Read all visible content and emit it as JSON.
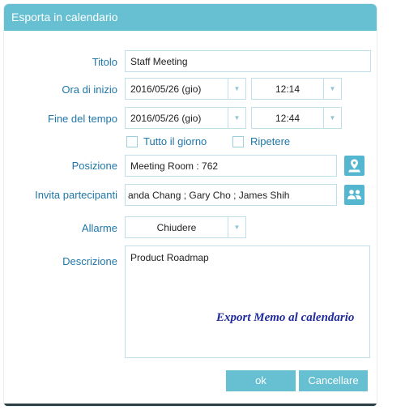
{
  "dialog": {
    "title": "Esporta in calendario"
  },
  "form": {
    "titolo": {
      "label": "Titolo",
      "value": "Staff Meeting"
    },
    "ora_inizio": {
      "label": "Ora di inizio",
      "date": "2016/05/26 (gio)",
      "time": "12:14"
    },
    "fine_tempo": {
      "label": "Fine del tempo",
      "date": "2016/05/26 (gio)",
      "time": "12:44"
    },
    "tutto_giorno": {
      "label": "Tutto il giorno",
      "checked": false
    },
    "ripetere": {
      "label": "Ripetere",
      "checked": false
    },
    "posizione": {
      "label": "Posizione",
      "value": "Meeting Room : 762",
      "icon": "location-pin-icon"
    },
    "invita": {
      "label": "Invita partecipanti",
      "value": "anda Chang ; Gary Cho ; James Shih",
      "icon": "people-icon"
    },
    "allarme": {
      "label": "Allarme",
      "value": "Chiudere"
    },
    "descrizione": {
      "label": "Descrizione",
      "value": "Product Roadmap"
    }
  },
  "buttons": {
    "ok": "ok",
    "cancel": "Cancellare"
  },
  "caption": "Export Memo al calendario",
  "colors": {
    "accent": "#67bfd2",
    "label": "#1f76a9",
    "field_border": "#bfe0e8",
    "caption": "#1e2a9e"
  }
}
